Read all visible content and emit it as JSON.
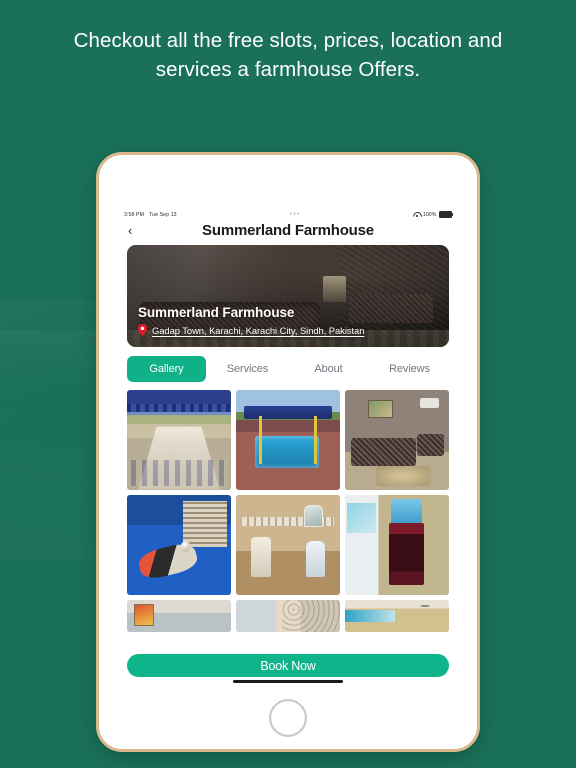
{
  "theme": {
    "background_green": "#1a7058",
    "accent_teal": "#10b188",
    "button_teal": "#0fb48a",
    "device_border_gold": "#dcb98a",
    "pin_red": "#e8192c"
  },
  "headline": {
    "text": "Checkout all the free slots, prices, location and services a farmhouse Offers."
  },
  "device": {
    "status_bar": {
      "time": "3:58 PM",
      "date": "Tue Sep 13",
      "multitask_indicator": "•••",
      "battery_percent": "100%",
      "wifi_icon": "wifi-icon",
      "battery_icon": "battery-icon"
    },
    "nav": {
      "back_icon": "chevron-left-icon",
      "title": "Summerland Farmhouse"
    },
    "hero": {
      "title": "Summerland Farmhouse",
      "location_icon": "map-pin-icon",
      "address": "Gadap Town, Karachi, Karachi City, Sindh, Pakistan"
    },
    "tabs": [
      {
        "label": "Gallery",
        "active": true
      },
      {
        "label": "Services",
        "active": false
      },
      {
        "label": "About",
        "active": false
      },
      {
        "label": "Reviews",
        "active": false
      }
    ],
    "gallery": {
      "rows": [
        [
          {
            "alt": "outdoor-dining-under-blue-canopy"
          },
          {
            "alt": "swimming-pool-with-blue-canopy"
          },
          {
            "alt": "living-room-with-sofas-and-chandelier"
          }
        ],
        [
          {
            "alt": "table-tennis-table-with-paddle-and-ball"
          },
          {
            "alt": "bathroom-with-toilet-and-sink"
          },
          {
            "alt": "water-dispenser-in-room"
          }
        ],
        [
          {
            "alt": "room-with-framed-painting"
          },
          {
            "alt": "wall-with-textured-finish"
          },
          {
            "alt": "hall-with-ceiling-fan"
          }
        ]
      ]
    },
    "book_button": {
      "label": "Book Now"
    },
    "home_button_icon": "home-circle-icon"
  }
}
